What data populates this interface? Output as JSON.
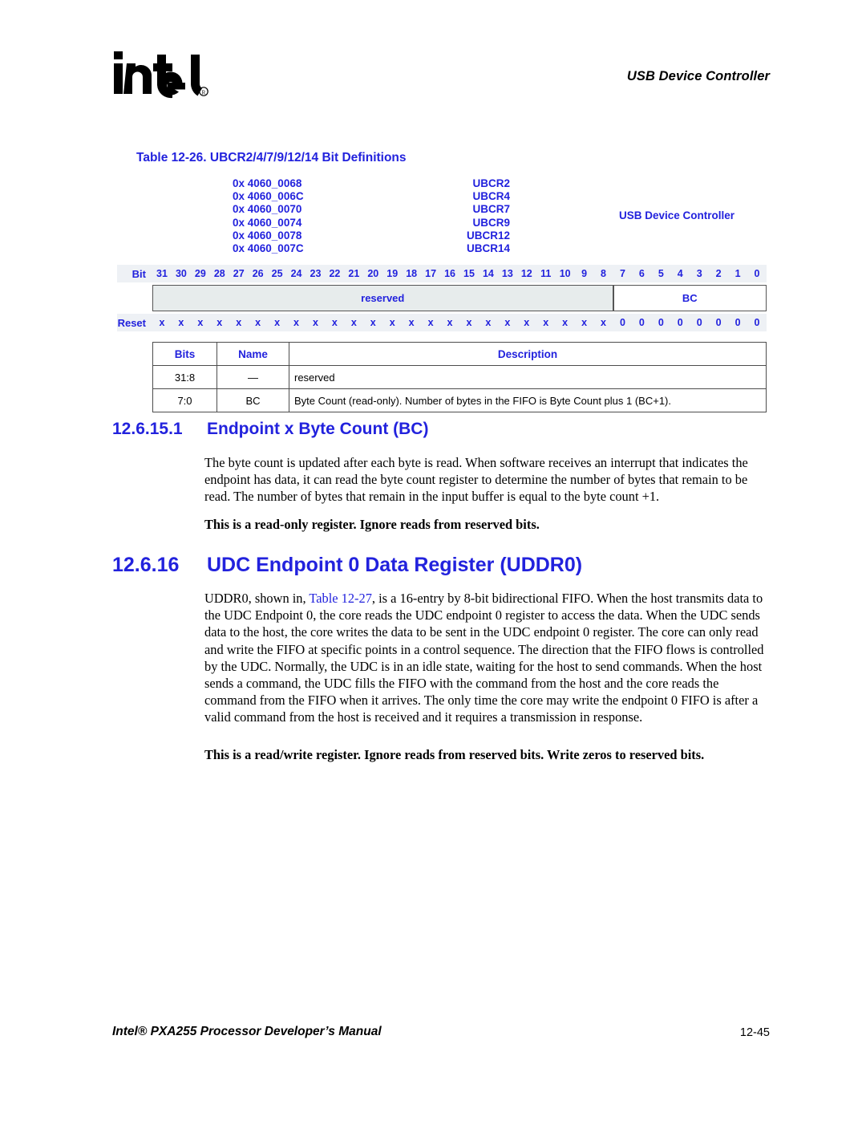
{
  "header": {
    "logo_text": "intel",
    "logo_mark": "registered-trademark",
    "title": "USB Device Controller"
  },
  "table_caption": "Table 12-26. UBCR2/4/7/9/12/14 Bit Definitions",
  "register_block": {
    "side_label": "USB Device Controller",
    "rows": [
      {
        "address": "0x 4060_0068",
        "name": "UBCR2"
      },
      {
        "address": "0x 4060_006C",
        "name": "UBCR4"
      },
      {
        "address": "0x 4060_0070",
        "name": "UBCR7"
      },
      {
        "address": "0x 4060_0074",
        "name": "UBCR9"
      },
      {
        "address": "0x 4060_0078",
        "name": "UBCR12"
      },
      {
        "address": "0x 4060_007C",
        "name": "UBCR14"
      }
    ]
  },
  "bit_diagram": {
    "bit_label": "Bit",
    "reset_label": "Reset",
    "bits": [
      "31",
      "30",
      "29",
      "28",
      "27",
      "26",
      "25",
      "24",
      "23",
      "22",
      "21",
      "20",
      "19",
      "18",
      "17",
      "16",
      "15",
      "14",
      "13",
      "12",
      "11",
      "10",
      "9",
      "8",
      "7",
      "6",
      "5",
      "4",
      "3",
      "2",
      "1",
      "0"
    ],
    "fields": [
      {
        "name": "reserved",
        "span": 24,
        "shaded": true
      },
      {
        "name": "BC",
        "span": 8,
        "shaded": false
      }
    ],
    "reset_values": [
      "x",
      "x",
      "x",
      "x",
      "x",
      "x",
      "x",
      "x",
      "x",
      "x",
      "x",
      "x",
      "x",
      "x",
      "x",
      "x",
      "x",
      "x",
      "x",
      "x",
      "x",
      "x",
      "x",
      "x",
      "0",
      "0",
      "0",
      "0",
      "0",
      "0",
      "0",
      "0"
    ]
  },
  "description_table": {
    "headers": [
      "Bits",
      "Name",
      "Description"
    ],
    "rows": [
      {
        "bits": "31:8",
        "name": "—",
        "description": "reserved"
      },
      {
        "bits": "7:0",
        "name": "BC",
        "description": "Byte Count (read-only). Number of bytes in the FIFO is Byte Count plus 1 (BC+1)."
      }
    ]
  },
  "sections": {
    "bc": {
      "number": "12.6.15.1",
      "title": "Endpoint x Byte Count (BC)",
      "paragraph": "The byte count is updated after each byte is read. When software receives an interrupt that indicates the endpoint has data, it can read the byte count register to determine the number of bytes that remain to be read. The number of bytes that remain in the input buffer is equal to the byte count +1.",
      "note": "This is a read-only register. Ignore reads from reserved bits."
    },
    "uddr0": {
      "number": "12.6.16",
      "title": "UDC Endpoint 0 Data Register (UDDR0)",
      "paragraph_part1": "UDDR0, shown in, ",
      "paragraph_link": "Table 12-27",
      "paragraph_part2": ", is a 16-entry by 8-bit bidirectional FIFO. When the host transmits data to the UDC Endpoint 0, the core reads the UDC endpoint 0 register to access the data. When the UDC sends data to the host, the core writes the data to be sent in the UDC endpoint 0 register. The core can only read and write the FIFO at specific points in a control sequence. The direction that the FIFO flows is controlled by the UDC. Normally, the UDC is in an idle state, waiting for the host to send commands. When the host sends a command, the UDC fills the FIFO with the command from the host and the core reads the command from the FIFO when it arrives. The only time the core may write the endpoint 0 FIFO is after a valid command from the host is received and it requires a transmission in response.",
      "note": "This is a read/write register. Ignore reads from reserved bits. Write zeros to reserved bits."
    }
  },
  "footer": {
    "manual_title": "Intel® PXA255 Processor Developer’s Manual",
    "page_number": "12-45"
  },
  "colors": {
    "blue": "#2222dd",
    "shaded_cell": "#e7ecec",
    "bit_row_band": "#eef1f5"
  }
}
